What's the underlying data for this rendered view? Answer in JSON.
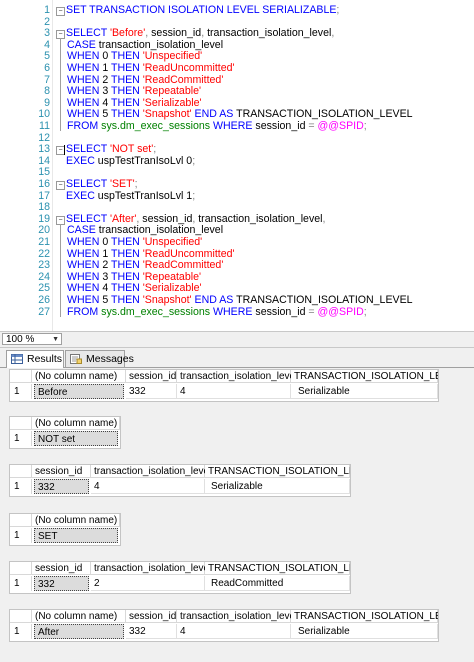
{
  "editor": {
    "lines": [
      {
        "n": "1",
        "segs": [
          [
            "kw",
            "SET TRANSACTION ISOLATION LEVEL SERIALIZABLE"
          ],
          [
            "gray",
            ";"
          ]
        ]
      },
      {
        "n": "2",
        "segs": []
      },
      {
        "n": "3",
        "segs": [
          [
            "kw",
            "SELECT "
          ],
          [
            "str",
            "'Before'"
          ],
          [
            "gray",
            ", "
          ],
          [
            "",
            "session_id"
          ],
          [
            "gray",
            ", "
          ],
          [
            "",
            "transaction_isolation_level"
          ],
          [
            "gray",
            ","
          ]
        ]
      },
      {
        "n": "4",
        "segs": [
          [
            "kw",
            "CASE "
          ],
          [
            "",
            "transaction_isolation_level"
          ]
        ]
      },
      {
        "n": "5",
        "segs": [
          [
            "kw",
            "WHEN "
          ],
          [
            "",
            "0 "
          ],
          [
            "kw",
            "THEN "
          ],
          [
            "str",
            "'Unspecified'"
          ]
        ]
      },
      {
        "n": "6",
        "segs": [
          [
            "kw",
            "WHEN "
          ],
          [
            "",
            "1 "
          ],
          [
            "kw",
            "THEN "
          ],
          [
            "str",
            "'ReadUncommitted'"
          ]
        ]
      },
      {
        "n": "7",
        "segs": [
          [
            "kw",
            "WHEN "
          ],
          [
            "",
            "2 "
          ],
          [
            "kw",
            "THEN "
          ],
          [
            "str",
            "'ReadCommitted'"
          ]
        ]
      },
      {
        "n": "8",
        "segs": [
          [
            "kw",
            "WHEN "
          ],
          [
            "",
            "3 "
          ],
          [
            "kw",
            "THEN "
          ],
          [
            "str",
            "'Repeatable'"
          ]
        ]
      },
      {
        "n": "9",
        "segs": [
          [
            "kw",
            "WHEN "
          ],
          [
            "",
            "4 "
          ],
          [
            "kw",
            "THEN "
          ],
          [
            "str",
            "'Serializable'"
          ]
        ]
      },
      {
        "n": "10",
        "segs": [
          [
            "kw",
            "WHEN "
          ],
          [
            "",
            "5 "
          ],
          [
            "kw",
            "THEN "
          ],
          [
            "str",
            "'Snapshot'"
          ],
          [
            "kw",
            " END AS "
          ],
          [
            "",
            "TRANSACTION_ISOLATION_LEVEL"
          ]
        ]
      },
      {
        "n": "11",
        "segs": [
          [
            "kw",
            "FROM "
          ],
          [
            "sys",
            "sys.dm_exec_sessions"
          ],
          [
            "kw",
            " WHERE "
          ],
          [
            "",
            "session_id "
          ],
          [
            "gray",
            "= "
          ],
          [
            "fn",
            "@@SPID"
          ],
          [
            "gray",
            ";"
          ]
        ]
      },
      {
        "n": "12",
        "segs": []
      },
      {
        "n": "13",
        "segs": [
          [
            "kw",
            "SELECT "
          ],
          [
            "str",
            "'NOT set'"
          ],
          [
            "gray",
            ";"
          ]
        ]
      },
      {
        "n": "14",
        "segs": [
          [
            "kw",
            "EXEC "
          ],
          [
            "",
            "uspTestTranIsoLvl 0"
          ],
          [
            "gray",
            ";"
          ]
        ]
      },
      {
        "n": "15",
        "segs": []
      },
      {
        "n": "16",
        "segs": [
          [
            "kw",
            "SELECT "
          ],
          [
            "str",
            "'SET'"
          ],
          [
            "gray",
            ";"
          ]
        ]
      },
      {
        "n": "17",
        "segs": [
          [
            "kw",
            "EXEC "
          ],
          [
            "",
            "uspTestTranIsoLvl 1"
          ],
          [
            "gray",
            ";"
          ]
        ]
      },
      {
        "n": "18",
        "segs": []
      },
      {
        "n": "19",
        "segs": [
          [
            "kw",
            "SELECT "
          ],
          [
            "str",
            "'After'"
          ],
          [
            "gray",
            ", "
          ],
          [
            "",
            "session_id"
          ],
          [
            "gray",
            ", "
          ],
          [
            "",
            "transaction_isolation_level"
          ],
          [
            "gray",
            ","
          ]
        ]
      },
      {
        "n": "20",
        "segs": [
          [
            "kw",
            "CASE "
          ],
          [
            "",
            "transaction_isolation_level"
          ]
        ]
      },
      {
        "n": "21",
        "segs": [
          [
            "kw",
            "WHEN "
          ],
          [
            "",
            "0 "
          ],
          [
            "kw",
            "THEN "
          ],
          [
            "str",
            "'Unspecified'"
          ]
        ]
      },
      {
        "n": "22",
        "segs": [
          [
            "kw",
            "WHEN "
          ],
          [
            "",
            "1 "
          ],
          [
            "kw",
            "THEN "
          ],
          [
            "str",
            "'ReadUncommitted'"
          ]
        ]
      },
      {
        "n": "23",
        "segs": [
          [
            "kw",
            "WHEN "
          ],
          [
            "",
            "2 "
          ],
          [
            "kw",
            "THEN "
          ],
          [
            "str",
            "'ReadCommitted'"
          ]
        ]
      },
      {
        "n": "24",
        "segs": [
          [
            "kw",
            "WHEN "
          ],
          [
            "",
            "3 "
          ],
          [
            "kw",
            "THEN "
          ],
          [
            "str",
            "'Repeatable'"
          ]
        ]
      },
      {
        "n": "25",
        "segs": [
          [
            "kw",
            "WHEN "
          ],
          [
            "",
            "4 "
          ],
          [
            "kw",
            "THEN "
          ],
          [
            "str",
            "'Serializable'"
          ]
        ]
      },
      {
        "n": "26",
        "segs": [
          [
            "kw",
            "WHEN "
          ],
          [
            "",
            "5 "
          ],
          [
            "kw",
            "THEN "
          ],
          [
            "str",
            "'Snapshot'"
          ],
          [
            "kw",
            " END AS "
          ],
          [
            "",
            "TRANSACTION_ISOLATION_LEVEL"
          ]
        ]
      },
      {
        "n": "27",
        "segs": [
          [
            "kw",
            "FROM "
          ],
          [
            "sys",
            "sys.dm_exec_sessions"
          ],
          [
            "kw",
            " WHERE "
          ],
          [
            "",
            "session_id "
          ],
          [
            "gray",
            "= "
          ],
          [
            "fn",
            "@@SPID"
          ],
          [
            "gray",
            ";"
          ]
        ]
      }
    ]
  },
  "zoom": {
    "value": "100 %"
  },
  "tabs": {
    "results": "Results",
    "messages": "Messages"
  },
  "colors": {
    "keyword": "#0000ff",
    "string": "#ff0000",
    "system": "#008000",
    "operator": "#808080",
    "function": "#ff00ff",
    "line_number": "#2b91af"
  },
  "grids": [
    {
      "headers": [
        "(No column name)",
        "session_id",
        "transaction_isolation_level",
        "TRANSACTION_ISOLATION_LEVEL"
      ],
      "rows": [
        [
          "1",
          "Before",
          "332",
          "4",
          "Serializable"
        ]
      ]
    },
    {
      "headers": [
        "(No column name)"
      ],
      "rows": [
        [
          "1",
          "NOT set"
        ]
      ]
    },
    {
      "headers": [
        "session_id",
        "transaction_isolation_level",
        "TRANSACTION_ISOLATION_LEVEL"
      ],
      "rows": [
        [
          "1",
          "332",
          "4",
          "Serializable"
        ]
      ]
    },
    {
      "headers": [
        "(No column name)"
      ],
      "rows": [
        [
          "1",
          "SET"
        ]
      ]
    },
    {
      "headers": [
        "session_id",
        "transaction_isolation_level",
        "TRANSACTION_ISOLATION_LEVEL"
      ],
      "rows": [
        [
          "1",
          "332",
          "2",
          "ReadCommitted"
        ]
      ]
    },
    {
      "headers": [
        "(No column name)",
        "session_id",
        "transaction_isolation_level",
        "TRANSACTION_ISOLATION_LEVEL"
      ],
      "rows": [
        [
          "1",
          "After",
          "332",
          "4",
          "Serializable"
        ]
      ]
    }
  ]
}
